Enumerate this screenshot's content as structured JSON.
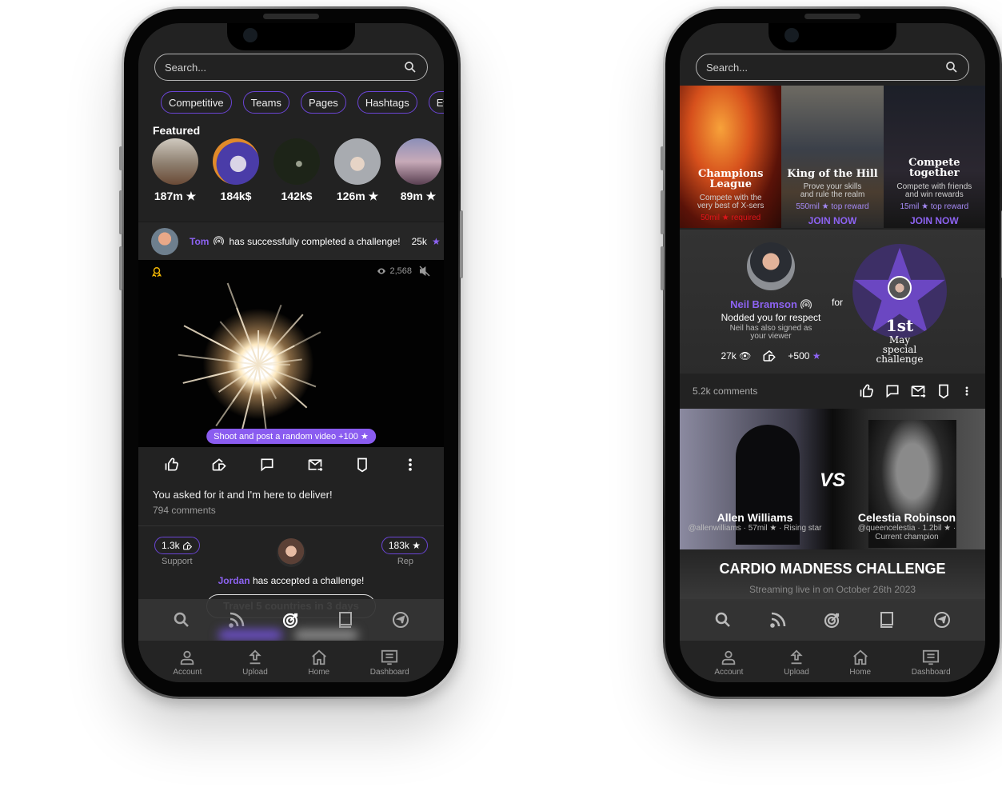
{
  "left_phone": {
    "search": {
      "placeholder": "Search..."
    },
    "chips": [
      "Competitive",
      "Teams",
      "Pages",
      "Hashtags",
      "Eve"
    ],
    "featured": {
      "title": "Featured",
      "items": [
        {
          "value": "187m ★"
        },
        {
          "value": "184k$"
        },
        {
          "value": "142k$"
        },
        {
          "value": "126m ★"
        },
        {
          "value": "89m ★"
        }
      ]
    },
    "activity": {
      "user": "Tom",
      "text": "has successfully completed a challenge!",
      "reward": "25k"
    },
    "video": {
      "views": "2,568",
      "challenge_pill": "Shoot and post a random video  +100 ★"
    },
    "post": {
      "caption": "You asked for it and I'm here to deliver!",
      "comments": "794 comments"
    },
    "accepted": {
      "support_value": "1.3k",
      "support_label": "Support",
      "rep_value": "183k ★",
      "rep_label": "Rep",
      "user": "Jordan",
      "text": "has accepted a challenge!",
      "challenge": "Travel 5 countries in 3 days"
    }
  },
  "right_phone": {
    "search": {
      "placeholder": "Search..."
    },
    "cards": [
      {
        "title": "Champions League",
        "desc": "Compete with the very best of X-sers",
        "reward": "50mil ★ required",
        "reward_color": "#e0141a",
        "join": ""
      },
      {
        "title": "King of the Hill",
        "desc": "Prove your skills and rule the realm",
        "reward": "550mil ★ top reward",
        "reward_color": "#a58af5",
        "join": "JOIN NOW"
      },
      {
        "title": "Compete together",
        "desc": "Compete with friends and win rewards",
        "reward": "15mil ★ top reward",
        "reward_color": "#a58af5",
        "join": "JOIN NOW"
      }
    ],
    "nod": {
      "name": "Neil Bramson",
      "action": "Nodded you for respect",
      "sub": "Neil has also signed as your viewer",
      "views": "27k",
      "points": "+500",
      "for": "for",
      "rank": "1st",
      "challenge": "May special challenge"
    },
    "comments": "5.2k comments",
    "versus": {
      "vs": "VS",
      "left_name": "Allen Williams",
      "left_meta": "@allenwilliams · 57mil ★ · Rising star",
      "right_name": "Celestia Robinson",
      "right_meta": "@queencelestia · 1.2bil ★ · Current champion"
    },
    "event": {
      "title": "CARDIO MADNESS CHALLENGE",
      "subtitle": "Streaming live in on October 26th 2023"
    }
  },
  "tabs": [
    {
      "label": "Account"
    },
    {
      "label": "Upload"
    },
    {
      "label": "Home"
    },
    {
      "label": "Dashboard"
    }
  ],
  "colors": {
    "accent": "#8d63f2",
    "chip_border": "#6b45d6",
    "required": "#e0141a",
    "badge": "#f2b705"
  }
}
